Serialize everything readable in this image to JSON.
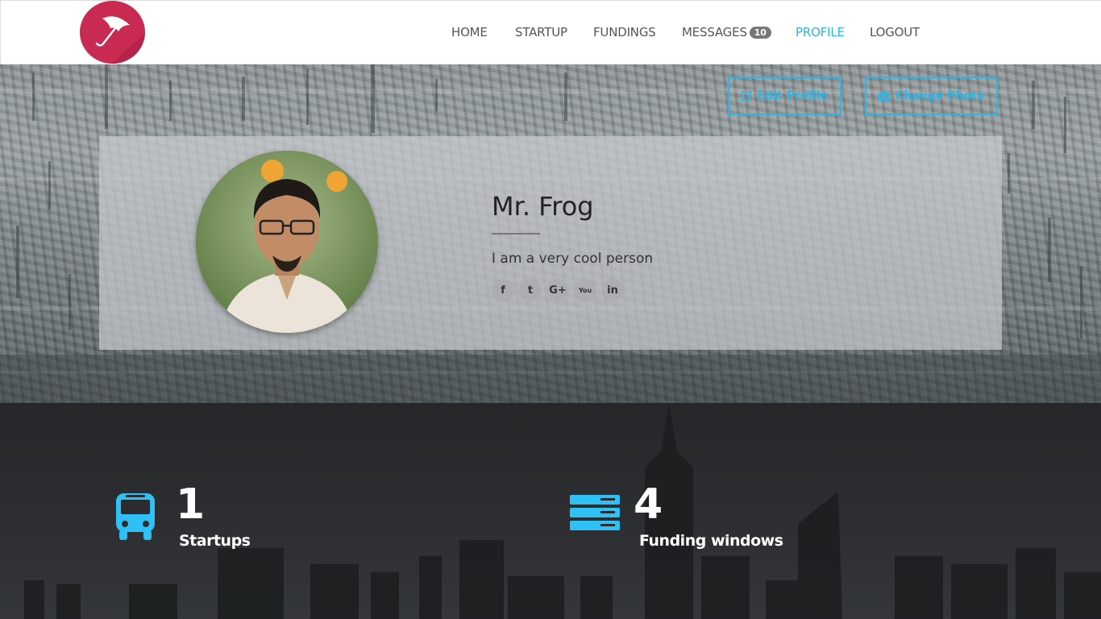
{
  "nav": {
    "logo_icon": "umbrella-icon",
    "items": [
      {
        "label": "HOME",
        "active": false
      },
      {
        "label": "STARTUP",
        "active": false
      },
      {
        "label": "FUNDINGS",
        "active": false
      },
      {
        "label": "MESSAGES",
        "active": false,
        "badge": "10"
      },
      {
        "label": "PROFILE",
        "active": true
      },
      {
        "label": "LOGOUT",
        "active": false
      }
    ]
  },
  "actions": {
    "edit_profile": "Edit Profile",
    "edit_icon": "edit-icon",
    "change_photo": "Change Photo",
    "change_photo_icon": "camera-icon"
  },
  "profile": {
    "name": "Mr. Frog",
    "bio": "I am a very cool person",
    "socials": [
      {
        "name": "facebook",
        "glyph": "f"
      },
      {
        "name": "twitter",
        "glyph": "t"
      },
      {
        "name": "google-plus",
        "glyph": "G+"
      },
      {
        "name": "youtube",
        "glyph": "You"
      },
      {
        "name": "linkedin",
        "glyph": "in"
      }
    ]
  },
  "stats": [
    {
      "value": "1",
      "label": "Startups",
      "icon": "bus-icon"
    },
    {
      "value": "4",
      "label": "Funding windows",
      "icon": "server-icon"
    }
  ],
  "colors": {
    "accent": "#29b6e8",
    "logo": "#c82a52",
    "active_nav": "#2bb5e3"
  }
}
